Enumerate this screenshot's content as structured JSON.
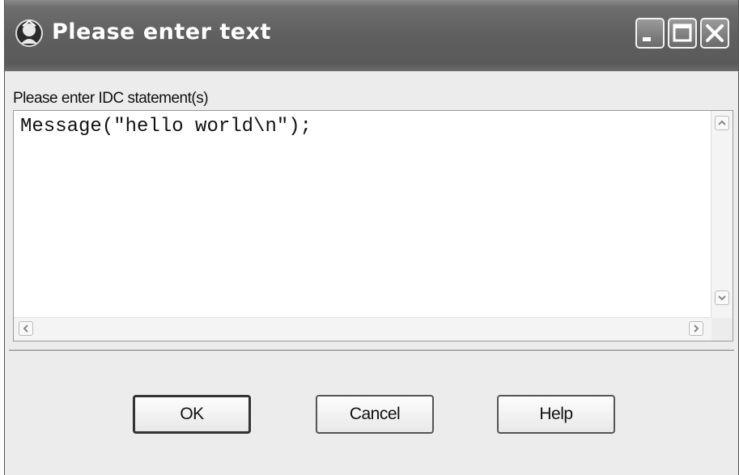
{
  "window": {
    "title": "Please enter text",
    "controls": [
      "minimize-icon",
      "maximize-icon",
      "close-icon"
    ]
  },
  "form": {
    "label": "Please enter IDC statement(s)",
    "code": "Message(\"hello world\\n\");"
  },
  "buttons": {
    "ok": "OK",
    "cancel": "Cancel",
    "help": "Help"
  }
}
